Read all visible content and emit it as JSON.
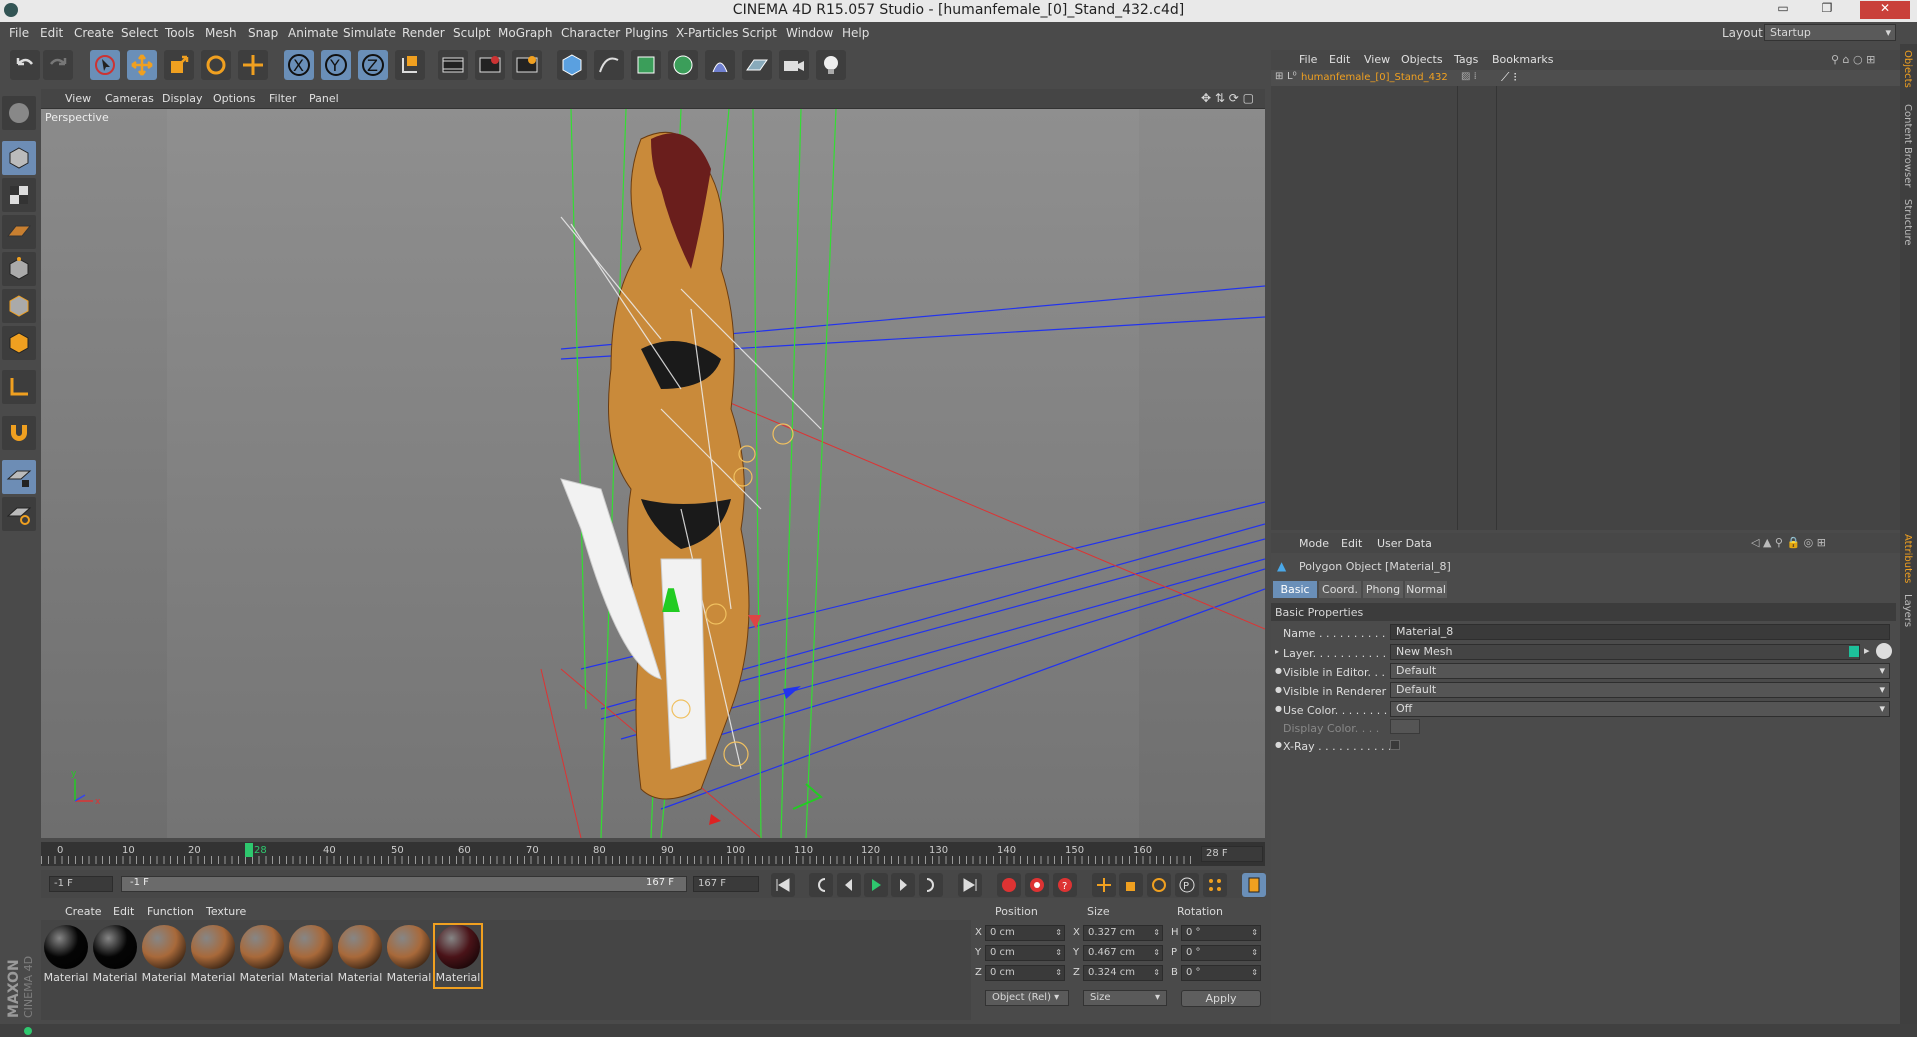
{
  "app": {
    "title": "CINEMA 4D R15.057 Studio - [humanfemale_[0]_Stand_432.c4d]"
  },
  "menu": [
    "File",
    "Edit",
    "Create",
    "Select",
    "Tools",
    "Mesh",
    "Snap",
    "Animate",
    "Simulate",
    "Render",
    "Sculpt",
    "MoGraph",
    "Character",
    "Plugins",
    "X-Particles",
    "Script",
    "Window",
    "Help"
  ],
  "layout": {
    "label": "Layout:",
    "value": "Startup"
  },
  "viewport": {
    "menu": [
      "View",
      "Cameras",
      "Display",
      "Options",
      "Filter",
      "Panel"
    ],
    "label": "Perspective"
  },
  "timeline": {
    "ticks": [
      "0",
      "10",
      "20",
      "28",
      "40",
      "50",
      "60",
      "70",
      "80",
      "90",
      "100",
      "110",
      "120",
      "130",
      "140",
      "150",
      "160"
    ],
    "current_frame": "28 F",
    "current_marker": "28"
  },
  "transport": {
    "start": "-1 F",
    "range_start": "-1 F",
    "range_end": "167 F",
    "end": "167 F"
  },
  "materials": {
    "menu": [
      "Create",
      "Edit",
      "Function",
      "Texture"
    ],
    "items": [
      {
        "label": "Material",
        "color": "#050505"
      },
      {
        "label": "Material",
        "color": "#050505"
      },
      {
        "label": "Material",
        "color": "#a8693a"
      },
      {
        "label": "Material",
        "color": "#a8693a"
      },
      {
        "label": "Material",
        "color": "#a8693a"
      },
      {
        "label": "Material",
        "color": "#a8693a"
      },
      {
        "label": "Material",
        "color": "#a8693a"
      },
      {
        "label": "Material",
        "color": "#a8693a"
      },
      {
        "label": "Material",
        "color": "#4a1318"
      }
    ]
  },
  "coords": {
    "headers": [
      "Position",
      "Size",
      "Rotation"
    ],
    "rows": [
      {
        "axis": "X",
        "pos": "0 cm",
        "saxis": "X",
        "size": "0.327 cm",
        "raxis": "H",
        "rot": "0 °"
      },
      {
        "axis": "Y",
        "pos": "0 cm",
        "saxis": "Y",
        "size": "0.467 cm",
        "raxis": "P",
        "rot": "0 °"
      },
      {
        "axis": "Z",
        "pos": "0 cm",
        "saxis": "Z",
        "size": "0.324 cm",
        "raxis": "B",
        "rot": "0 °"
      }
    ],
    "mode": "Object (Rel)",
    "size_mode": "Size",
    "apply": "Apply"
  },
  "objects": {
    "menu": [
      "File",
      "Edit",
      "View",
      "Objects",
      "Tags",
      "Bookmarks"
    ],
    "item": "humanfemale_[0]_Stand_432"
  },
  "attributes": {
    "menu": [
      "Mode",
      "Edit",
      "User Data"
    ],
    "object_title": "Polygon Object [Material_8]",
    "tabs": [
      "Basic",
      "Coord.",
      "Phong",
      "Normal"
    ],
    "section": "Basic Properties",
    "props": [
      {
        "label": "Name . . . . . . . . . . . .",
        "value": "Material_8"
      },
      {
        "label": "Layer. . . . . . . . . . . . .",
        "value": "New Mesh"
      },
      {
        "label": "Visible in Editor. . .",
        "value": "Default"
      },
      {
        "label": "Visible in Renderer",
        "value": "Default"
      },
      {
        "label": "Use Color. . . . . . . .",
        "value": "Off"
      },
      {
        "label": "Display Color. . . .",
        "value": ""
      },
      {
        "label": "X-Ray . . . . . . . . . . .",
        "value": ""
      }
    ]
  },
  "side_tabs": [
    "Objects",
    "Content Browser",
    "Structure",
    "Attributes",
    "Layers"
  ],
  "brand": "MAXON CINEMA 4D"
}
